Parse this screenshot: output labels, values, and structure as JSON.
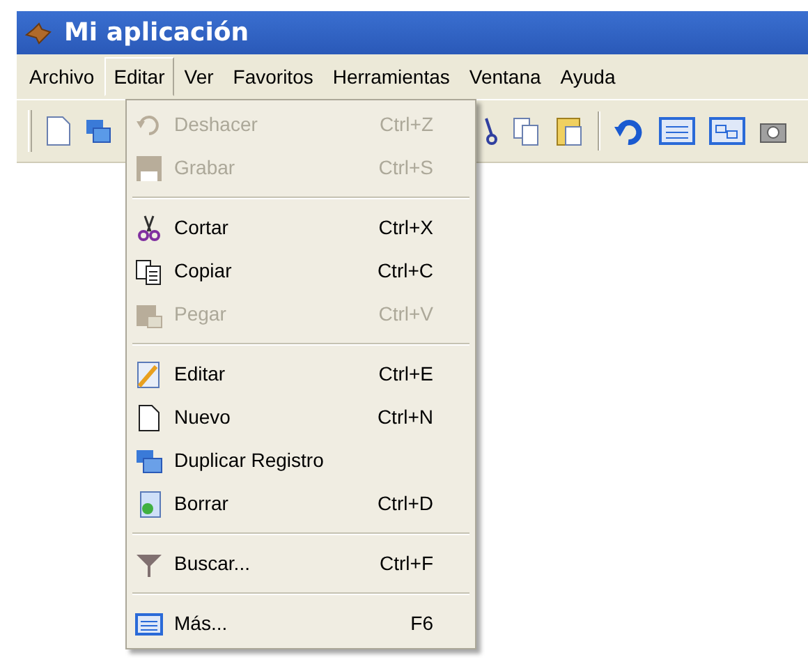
{
  "window": {
    "title": "Mi aplicación"
  },
  "menu_bar": [
    {
      "label": "Archivo",
      "selected": false
    },
    {
      "label": "Editar",
      "selected": true
    },
    {
      "label": "Ver",
      "selected": false
    },
    {
      "label": "Favoritos",
      "selected": false
    },
    {
      "label": "Herramientas",
      "selected": false
    },
    {
      "label": "Ventana",
      "selected": false
    },
    {
      "label": "Ayuda",
      "selected": false
    }
  ],
  "edit_menu": [
    {
      "kind": "item",
      "label": "Deshacer",
      "shortcut": "Ctrl+Z",
      "disabled": true
    },
    {
      "kind": "item",
      "label": "Grabar",
      "shortcut": "Ctrl+S",
      "disabled": true
    },
    {
      "kind": "separator"
    },
    {
      "kind": "item",
      "label": "Cortar",
      "shortcut": "Ctrl+X",
      "disabled": false
    },
    {
      "kind": "item",
      "label": "Copiar",
      "shortcut": "Ctrl+C",
      "disabled": false
    },
    {
      "kind": "item",
      "label": "Pegar",
      "shortcut": "Ctrl+V",
      "disabled": true
    },
    {
      "kind": "separator"
    },
    {
      "kind": "item",
      "label": "Editar",
      "shortcut": "Ctrl+E",
      "disabled": false
    },
    {
      "kind": "item",
      "label": "Nuevo",
      "shortcut": "Ctrl+N",
      "disabled": false
    },
    {
      "kind": "item",
      "label": "Duplicar Registro",
      "disabled": false
    },
    {
      "kind": "item",
      "label": "Borrar",
      "shortcut": "Ctrl+D",
      "disabled": false
    },
    {
      "kind": "separator"
    },
    {
      "kind": "item",
      "label": "Buscar...",
      "shortcut": "Ctrl+F",
      "disabled": false
    },
    {
      "kind": "separator"
    },
    {
      "kind": "item",
      "label": "Más...",
      "shortcut": "F6",
      "disabled": false
    }
  ]
}
